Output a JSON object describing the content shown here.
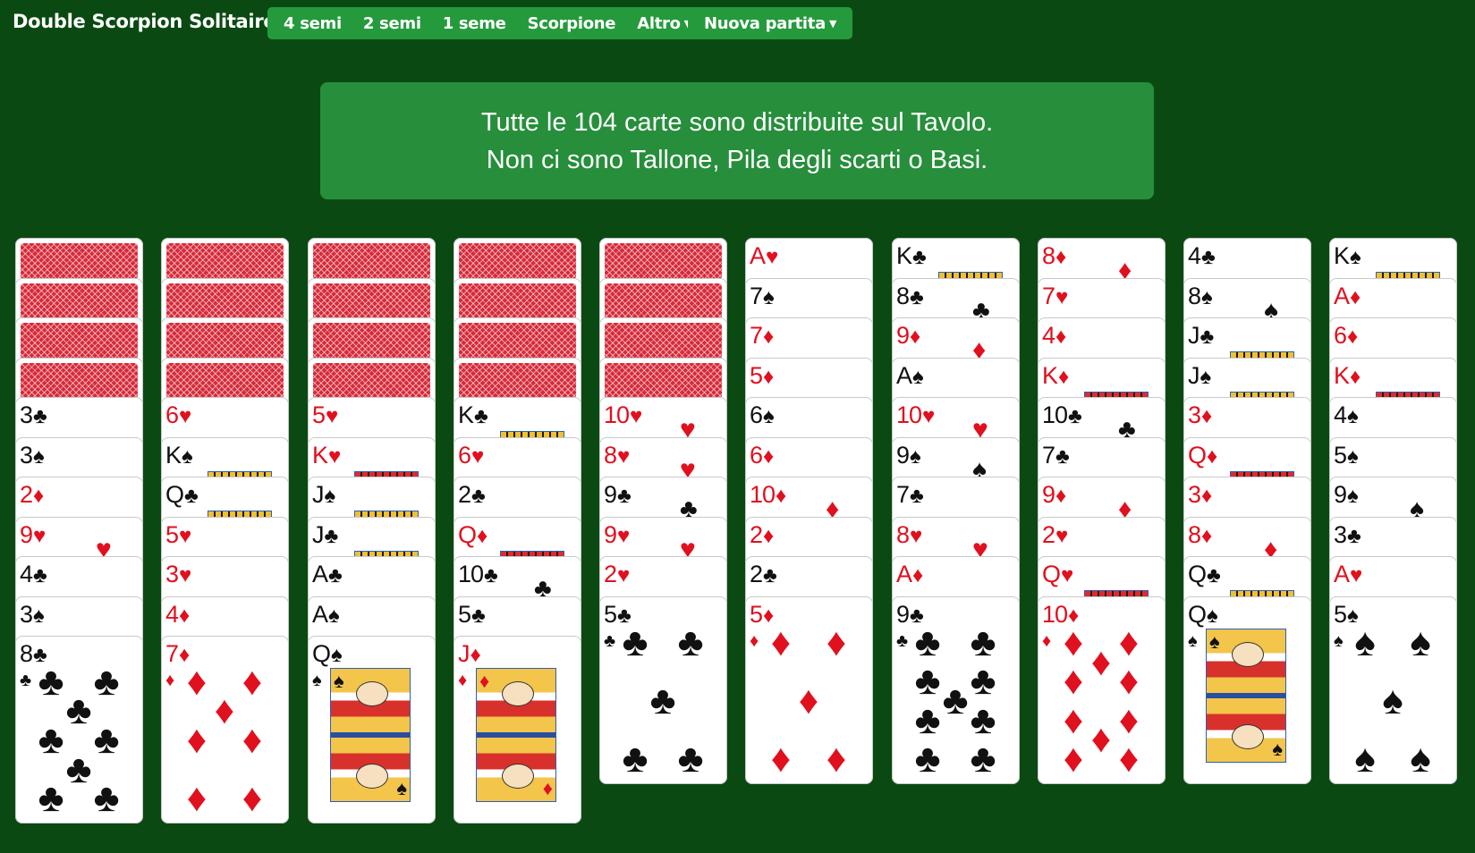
{
  "header": {
    "title": "Double Scorpion Solitaired",
    "variant_menu": [
      "4 semi",
      "2 semi",
      "1 seme",
      "Scorpione",
      "Altro"
    ],
    "new_game": "Nuova partita"
  },
  "info": {
    "line1": "Tutte le 104 carte sono distribuite sul Tavolo.",
    "line2": "Non ci sono Tallone, Pila degli scarti o Basi."
  },
  "colors": {
    "background": "#0a4a12",
    "menu": "#259a3c",
    "info_box": "#278e3b",
    "card_red": "#e0101e",
    "card_back": "#d62b3a"
  },
  "tableau": [
    {
      "face_down": 4,
      "cards": [
        {
          "rank": "3",
          "suit": "♣"
        },
        {
          "rank": "3",
          "suit": "♠"
        },
        {
          "rank": "2",
          "suit": "♦"
        },
        {
          "rank": "9",
          "suit": "♥"
        },
        {
          "rank": "4",
          "suit": "♣"
        },
        {
          "rank": "3",
          "suit": "♠"
        },
        {
          "rank": "8",
          "suit": "♣"
        }
      ]
    },
    {
      "face_down": 4,
      "cards": [
        {
          "rank": "6",
          "suit": "♥"
        },
        {
          "rank": "K",
          "suit": "♠"
        },
        {
          "rank": "Q",
          "suit": "♣"
        },
        {
          "rank": "5",
          "suit": "♥"
        },
        {
          "rank": "3",
          "suit": "♥"
        },
        {
          "rank": "4",
          "suit": "♦"
        },
        {
          "rank": "7",
          "suit": "♦"
        }
      ]
    },
    {
      "face_down": 4,
      "cards": [
        {
          "rank": "5",
          "suit": "♥"
        },
        {
          "rank": "K",
          "suit": "♥"
        },
        {
          "rank": "J",
          "suit": "♠"
        },
        {
          "rank": "J",
          "suit": "♣"
        },
        {
          "rank": "A",
          "suit": "♣"
        },
        {
          "rank": "A",
          "suit": "♠"
        },
        {
          "rank": "Q",
          "suit": "♠"
        }
      ]
    },
    {
      "face_down": 4,
      "cards": [
        {
          "rank": "K",
          "suit": "♣"
        },
        {
          "rank": "6",
          "suit": "♥"
        },
        {
          "rank": "2",
          "suit": "♣"
        },
        {
          "rank": "Q",
          "suit": "♦"
        },
        {
          "rank": "10",
          "suit": "♣"
        },
        {
          "rank": "5",
          "suit": "♣"
        },
        {
          "rank": "J",
          "suit": "♦"
        }
      ]
    },
    {
      "face_down": 4,
      "cards": [
        {
          "rank": "10",
          "suit": "♥"
        },
        {
          "rank": "8",
          "suit": "♥"
        },
        {
          "rank": "9",
          "suit": "♣"
        },
        {
          "rank": "9",
          "suit": "♥"
        },
        {
          "rank": "2",
          "suit": "♥"
        },
        {
          "rank": "5",
          "suit": "♣"
        }
      ]
    },
    {
      "face_down": 0,
      "cards": [
        {
          "rank": "A",
          "suit": "♥"
        },
        {
          "rank": "7",
          "suit": "♠"
        },
        {
          "rank": "7",
          "suit": "♦"
        },
        {
          "rank": "5",
          "suit": "♦"
        },
        {
          "rank": "6",
          "suit": "♠"
        },
        {
          "rank": "6",
          "suit": "♦"
        },
        {
          "rank": "10",
          "suit": "♦"
        },
        {
          "rank": "2",
          "suit": "♦"
        },
        {
          "rank": "2",
          "suit": "♣"
        },
        {
          "rank": "5",
          "suit": "♦"
        }
      ]
    },
    {
      "face_down": 0,
      "cards": [
        {
          "rank": "K",
          "suit": "♣"
        },
        {
          "rank": "8",
          "suit": "♣"
        },
        {
          "rank": "9",
          "suit": "♦"
        },
        {
          "rank": "A",
          "suit": "♠"
        },
        {
          "rank": "10",
          "suit": "♥"
        },
        {
          "rank": "9",
          "suit": "♠"
        },
        {
          "rank": "7",
          "suit": "♣"
        },
        {
          "rank": "8",
          "suit": "♥"
        },
        {
          "rank": "A",
          "suit": "♦"
        },
        {
          "rank": "9",
          "suit": "♣"
        }
      ]
    },
    {
      "face_down": 0,
      "cards": [
        {
          "rank": "8",
          "suit": "♦"
        },
        {
          "rank": "7",
          "suit": "♥"
        },
        {
          "rank": "4",
          "suit": "♦"
        },
        {
          "rank": "K",
          "suit": "♦"
        },
        {
          "rank": "10",
          "suit": "♣"
        },
        {
          "rank": "7",
          "suit": "♣"
        },
        {
          "rank": "9",
          "suit": "♦"
        },
        {
          "rank": "2",
          "suit": "♥"
        },
        {
          "rank": "Q",
          "suit": "♥"
        },
        {
          "rank": "10",
          "suit": "♦"
        }
      ]
    },
    {
      "face_down": 0,
      "cards": [
        {
          "rank": "4",
          "suit": "♣"
        },
        {
          "rank": "8",
          "suit": "♠"
        },
        {
          "rank": "J",
          "suit": "♣"
        },
        {
          "rank": "J",
          "suit": "♠"
        },
        {
          "rank": "3",
          "suit": "♦"
        },
        {
          "rank": "Q",
          "suit": "♦"
        },
        {
          "rank": "3",
          "suit": "♦"
        },
        {
          "rank": "8",
          "suit": "♦"
        },
        {
          "rank": "Q",
          "suit": "♣"
        },
        {
          "rank": "Q",
          "suit": "♠"
        }
      ]
    },
    {
      "face_down": 0,
      "cards": [
        {
          "rank": "K",
          "suit": "♠"
        },
        {
          "rank": "A",
          "suit": "♦"
        },
        {
          "rank": "6",
          "suit": "♦"
        },
        {
          "rank": "K",
          "suit": "♦"
        },
        {
          "rank": "4",
          "suit": "♠"
        },
        {
          "rank": "5",
          "suit": "♠"
        },
        {
          "rank": "9",
          "suit": "♠"
        },
        {
          "rank": "3",
          "suit": "♣"
        },
        {
          "rank": "A",
          "suit": "♥"
        },
        {
          "rank": "5",
          "suit": "♠"
        }
      ]
    }
  ]
}
